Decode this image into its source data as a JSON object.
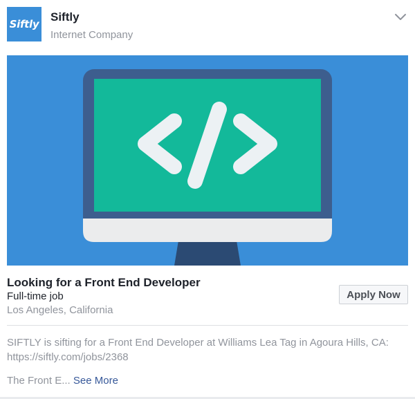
{
  "page": {
    "logo_text": "Siftly",
    "name": "Siftly",
    "category": "Internet Company",
    "brand_color": "#3a8ed8"
  },
  "header": {
    "menu_icon": "chevron-down-icon"
  },
  "hero": {
    "icon": "code-monitor-icon",
    "code_symbol": "</>"
  },
  "job": {
    "title": "Looking for a Front End Developer",
    "type": "Full-time job",
    "location": "Los Angeles, California",
    "apply_label": "Apply Now"
  },
  "post": {
    "line1": "SIFTLY is sifting for a Front End Developer at Williams Lea Tag in Agoura Hills, CA:",
    "line2": "https://siftly.com/jobs/2368",
    "truncated": "The Front E...",
    "see_more": "See More"
  }
}
